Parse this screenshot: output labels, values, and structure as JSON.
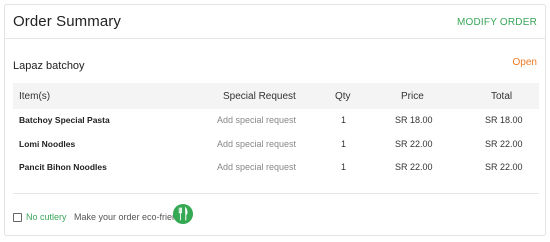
{
  "header": {
    "title": "Order Summary",
    "modify_label": "MODIFY ORDER"
  },
  "restaurant": {
    "name": "Lapaz batchoy",
    "status": "Open",
    "status_color": "#f07a22"
  },
  "table": {
    "columns": [
      "Item(s)",
      "Special Request",
      "Qty",
      "Price",
      "Total"
    ],
    "rows": [
      {
        "item": "Batchoy Special Pasta",
        "special": "Add special request",
        "qty": "1",
        "price": "SR  18.00",
        "total": "SR  18.00"
      },
      {
        "item": "Lomi Noodles",
        "special": "Add special request",
        "qty": "1",
        "price": "SR  22.00",
        "total": "SR  22.00"
      },
      {
        "item": "Pancit Bihon Noodles",
        "special": "Add special request",
        "qty": "1",
        "price": "SR  22.00",
        "total": "SR  22.00"
      }
    ]
  },
  "footer": {
    "cutlery_label": "No cutlery",
    "eco_text": "Make your order eco-friendly",
    "eco_icon": "fork-knife-icon",
    "accent_color": "#3aa55a"
  }
}
